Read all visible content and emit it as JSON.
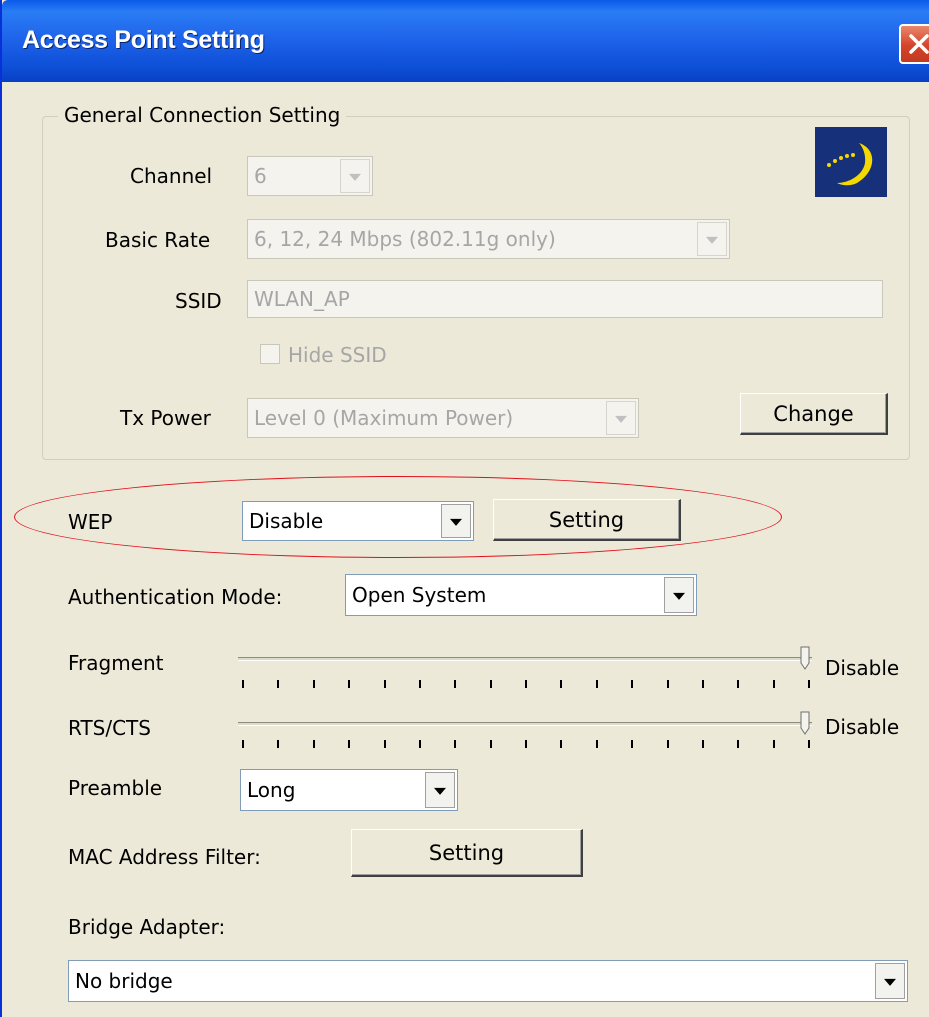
{
  "window": {
    "title": "Access Point Setting"
  },
  "general": {
    "group_title": "General Connection Setting",
    "channel_label": "Channel",
    "channel_value": "6",
    "basic_rate_label": "Basic Rate",
    "basic_rate_value": "6, 12, 24 Mbps (802.11g only)",
    "ssid_label": "SSID",
    "ssid_value": "WLAN_AP",
    "hide_ssid_label": "Hide SSID",
    "hide_ssid_checked": false,
    "tx_power_label": "Tx Power",
    "tx_power_value": "Level 0 (Maximum Power)",
    "change_button": "Change"
  },
  "wep": {
    "label": "WEP",
    "value": "Disable",
    "setting_button": "Setting"
  },
  "auth": {
    "label": "Authentication Mode:",
    "value": "Open System"
  },
  "fragment": {
    "label": "Fragment",
    "value_label": "Disable",
    "level": 1.0
  },
  "rts_cts": {
    "label": "RTS/CTS",
    "value_label": "Disable",
    "level": 1.0
  },
  "preamble": {
    "label": "Preamble",
    "value": "Long"
  },
  "mac_filter": {
    "label": "MAC Address Filter:",
    "setting_button": "Setting"
  },
  "bridge": {
    "label": "Bridge Adapter:",
    "value": "No bridge"
  },
  "icons": {
    "close": "close-icon",
    "logo": "wireless-logo-icon",
    "dropdown": "chevron-down-icon",
    "annotation": "red-ellipse-highlight"
  },
  "colors": {
    "titlebar": "#0d4fd6",
    "dialog_bg": "#ece9d8",
    "close_button": "#d5432a",
    "highlight": "#e0101a",
    "logo_bg": "#16307a",
    "logo_moon": "#f5d800"
  }
}
